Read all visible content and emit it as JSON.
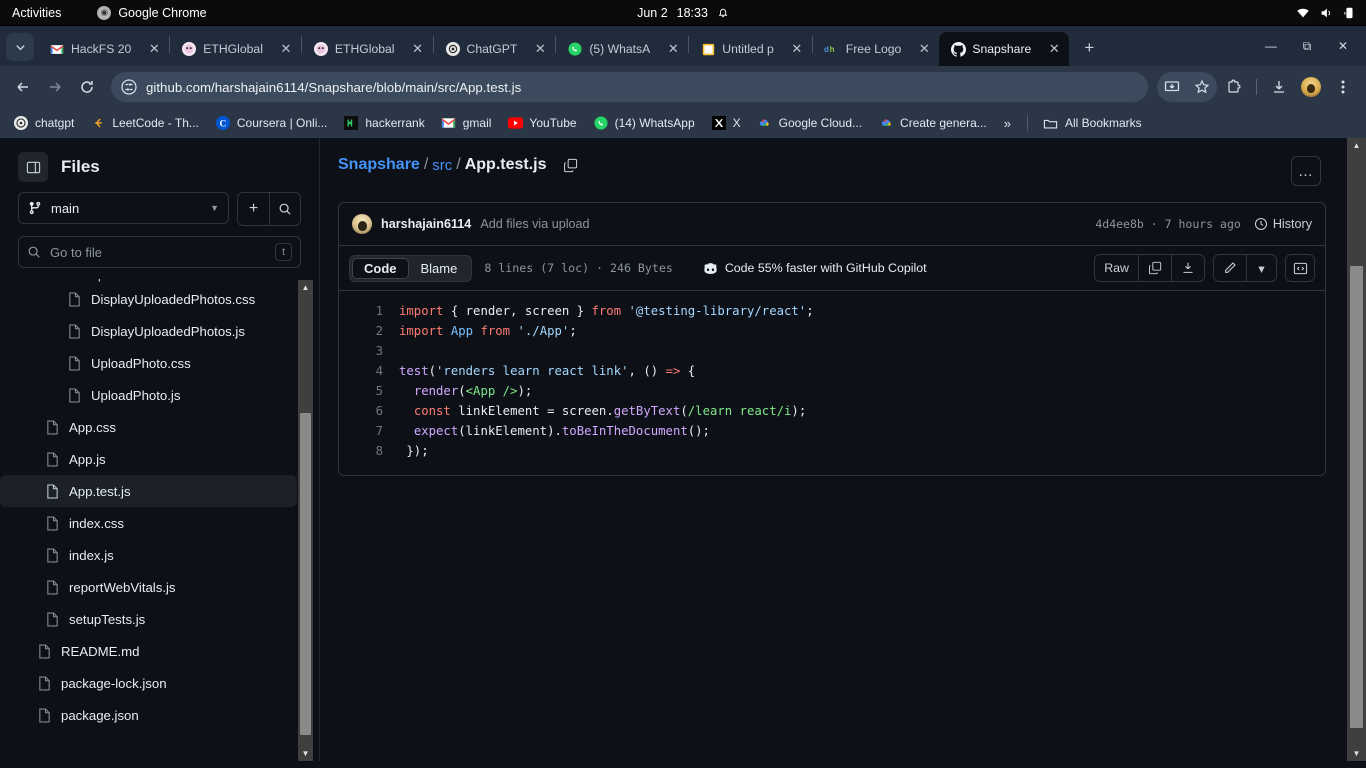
{
  "os_bar": {
    "activities": "Activities",
    "app_name": "Google Chrome",
    "date": "Jun 2",
    "time": "18:33",
    "icons": [
      "bell-icon",
      "wifi-icon",
      "volume-icon",
      "battery-icon"
    ]
  },
  "browser": {
    "tabs": [
      {
        "title": "HackFS 20",
        "favicon": "gmail-icon",
        "active": false
      },
      {
        "title": "ETHGlobal",
        "favicon": "ethglobal-icon",
        "active": false
      },
      {
        "title": "ETHGlobal",
        "favicon": "ethglobal-icon",
        "active": false
      },
      {
        "title": "ChatGPT",
        "favicon": "chatgpt-icon",
        "active": false
      },
      {
        "title": "(5) WhatsA",
        "favicon": "whatsapp-icon",
        "active": false
      },
      {
        "title": "Untitled p",
        "favicon": "document-icon",
        "active": false
      },
      {
        "title": "Free Logo",
        "favicon": "designhill-icon",
        "active": false
      },
      {
        "title": "Snapshare",
        "favicon": "github-icon",
        "active": true
      }
    ],
    "new_tab_label": "+",
    "window_controls": {
      "minimize": "—",
      "maximize": "⧉",
      "close": "✕"
    },
    "url": "github.com/harshajain6114/Snapshare/blob/main/src/App.test.js",
    "nav": {
      "back": "back-icon",
      "forward": "forward-icon",
      "reload": "reload-icon"
    },
    "toolbar_icons": [
      "install-icon",
      "bookmark-star-icon",
      "extensions-icon",
      "downloads-icon",
      "profile-avatar",
      "chrome-menu-icon"
    ],
    "bookmarks": [
      {
        "label": "chatgpt",
        "icon": "chatgpt-icon"
      },
      {
        "label": "LeetCode - Th...",
        "icon": "leetcode-icon"
      },
      {
        "label": "Coursera | Onli...",
        "icon": "coursera-icon"
      },
      {
        "label": "hackerrank",
        "icon": "hackerrank-icon"
      },
      {
        "label": "gmail",
        "icon": "gmail-icon"
      },
      {
        "label": "YouTube",
        "icon": "youtube-icon"
      },
      {
        "label": "(14) WhatsApp",
        "icon": "whatsapp-icon"
      },
      {
        "label": "X",
        "icon": "x-icon"
      },
      {
        "label": "Google Cloud...",
        "icon": "google-cloud-icon"
      },
      {
        "label": "Create genera...",
        "icon": "google-cloud-icon"
      }
    ],
    "bookmarks_overflow": "»",
    "all_bookmarks": "All Bookmarks"
  },
  "sidebar": {
    "title": "Files",
    "toggle_icon": "sidebar-toggle-icon",
    "branch": "main",
    "add_label": "+",
    "search_icon": "search-icon",
    "go_to_file_placeholder": "Go to file",
    "go_to_file_kbd": "t",
    "tree": [
      {
        "name": "components",
        "type": "folder",
        "indent": 1,
        "selected": false,
        "partial": true
      },
      {
        "name": "DisplayUploadedPhotos.css",
        "type": "file",
        "indent": 2,
        "selected": false
      },
      {
        "name": "DisplayUploadedPhotos.js",
        "type": "file",
        "indent": 2,
        "selected": false
      },
      {
        "name": "UploadPhoto.css",
        "type": "file",
        "indent": 2,
        "selected": false
      },
      {
        "name": "UploadPhoto.js",
        "type": "file",
        "indent": 2,
        "selected": false
      },
      {
        "name": "App.css",
        "type": "file",
        "indent": 1,
        "selected": false
      },
      {
        "name": "App.js",
        "type": "file",
        "indent": 1,
        "selected": false
      },
      {
        "name": "App.test.js",
        "type": "file",
        "indent": 1,
        "selected": true
      },
      {
        "name": "index.css",
        "type": "file",
        "indent": 1,
        "selected": false
      },
      {
        "name": "index.js",
        "type": "file",
        "indent": 1,
        "selected": false
      },
      {
        "name": "reportWebVitals.js",
        "type": "file",
        "indent": 1,
        "selected": false
      },
      {
        "name": "setupTests.js",
        "type": "file",
        "indent": 1,
        "selected": false
      },
      {
        "name": "README.md",
        "type": "file",
        "indent": 0,
        "selected": false
      },
      {
        "name": "package-lock.json",
        "type": "file",
        "indent": 0,
        "selected": false
      },
      {
        "name": "package.json",
        "type": "file",
        "indent": 0,
        "selected": false
      }
    ]
  },
  "main": {
    "breadcrumb": {
      "repo": "Snapshare",
      "sep": "/",
      "dir": "src",
      "file": "App.test.js"
    },
    "copy_path_icon": "copy-icon",
    "kebab_label": "…",
    "commit": {
      "author": "harshajain6114",
      "message": "Add files via upload",
      "sha": "4d4ee8b",
      "dot": "·",
      "time": "7 hours ago",
      "history_label": "History",
      "history_icon": "history-icon"
    },
    "code_toolbar": {
      "tab_code": "Code",
      "tab_blame": "Blame",
      "meta": "8 lines (7 loc) · 246 Bytes",
      "copilot_text": "Code 55% faster with GitHub Copilot",
      "copilot_icon": "copilot-icon",
      "raw_label": "Raw",
      "copy_icon": "copy-raw-icon",
      "download_icon": "download-icon",
      "edit_icon": "pencil-icon",
      "edit_caret": "▾",
      "symbols_icon": "code-brackets-icon"
    },
    "code": {
      "lines": [
        {
          "n": "1",
          "tokens": [
            {
              "t": "import ",
              "c": "t-kw"
            },
            {
              "t": "{ render, screen } ",
              "c": "t-var"
            },
            {
              "t": "from ",
              "c": "t-kw"
            },
            {
              "t": "'@testing-library/react'",
              "c": "t-str"
            },
            {
              "t": ";",
              "c": "t-var"
            }
          ]
        },
        {
          "n": "2",
          "tokens": [
            {
              "t": "import ",
              "c": "t-kw"
            },
            {
              "t": "App ",
              "c": "t-const"
            },
            {
              "t": "from ",
              "c": "t-kw"
            },
            {
              "t": "'./App'",
              "c": "t-str"
            },
            {
              "t": ";",
              "c": "t-var"
            }
          ]
        },
        {
          "n": "3",
          "tokens": []
        },
        {
          "n": "4",
          "tokens": [
            {
              "t": "test",
              "c": "t-fn"
            },
            {
              "t": "(",
              "c": "t-var"
            },
            {
              "t": "'renders learn react link'",
              "c": "t-str"
            },
            {
              "t": ", () ",
              "c": "t-var"
            },
            {
              "t": "=>",
              "c": "t-kw"
            },
            {
              "t": " {",
              "c": "t-var"
            }
          ]
        },
        {
          "n": "5",
          "tokens": [
            {
              "t": "  ",
              "c": "t-var"
            },
            {
              "t": "render",
              "c": "t-fn"
            },
            {
              "t": "(",
              "c": "t-var"
            },
            {
              "t": "<App />",
              "c": "t-tag"
            },
            {
              "t": ");",
              "c": "t-var"
            }
          ]
        },
        {
          "n": "6",
          "tokens": [
            {
              "t": "  ",
              "c": "t-var"
            },
            {
              "t": "const",
              "c": "t-kw"
            },
            {
              "t": " linkElement = screen.",
              "c": "t-var"
            },
            {
              "t": "getByText",
              "c": "t-fn"
            },
            {
              "t": "(",
              "c": "t-var"
            },
            {
              "t": "/learn react/i",
              "c": "t-re"
            },
            {
              "t": ");",
              "c": "t-var"
            }
          ]
        },
        {
          "n": "7",
          "tokens": [
            {
              "t": "  ",
              "c": "t-var"
            },
            {
              "t": "expect",
              "c": "t-fn"
            },
            {
              "t": "(linkElement).",
              "c": "t-var"
            },
            {
              "t": "toBeInTheDocument",
              "c": "t-fn"
            },
            {
              "t": "();",
              "c": "t-var"
            }
          ]
        },
        {
          "n": "8",
          "tokens": [
            {
              "t": " });",
              "c": "t-var"
            }
          ]
        }
      ]
    }
  },
  "colors": {
    "page_bg": "#0d1117",
    "chrome_bg": "#2b3747",
    "tabstrip_bg": "#202c3b",
    "accent_link": "#4493f8",
    "selected_bar": "#316dca",
    "border": "#30363d"
  }
}
